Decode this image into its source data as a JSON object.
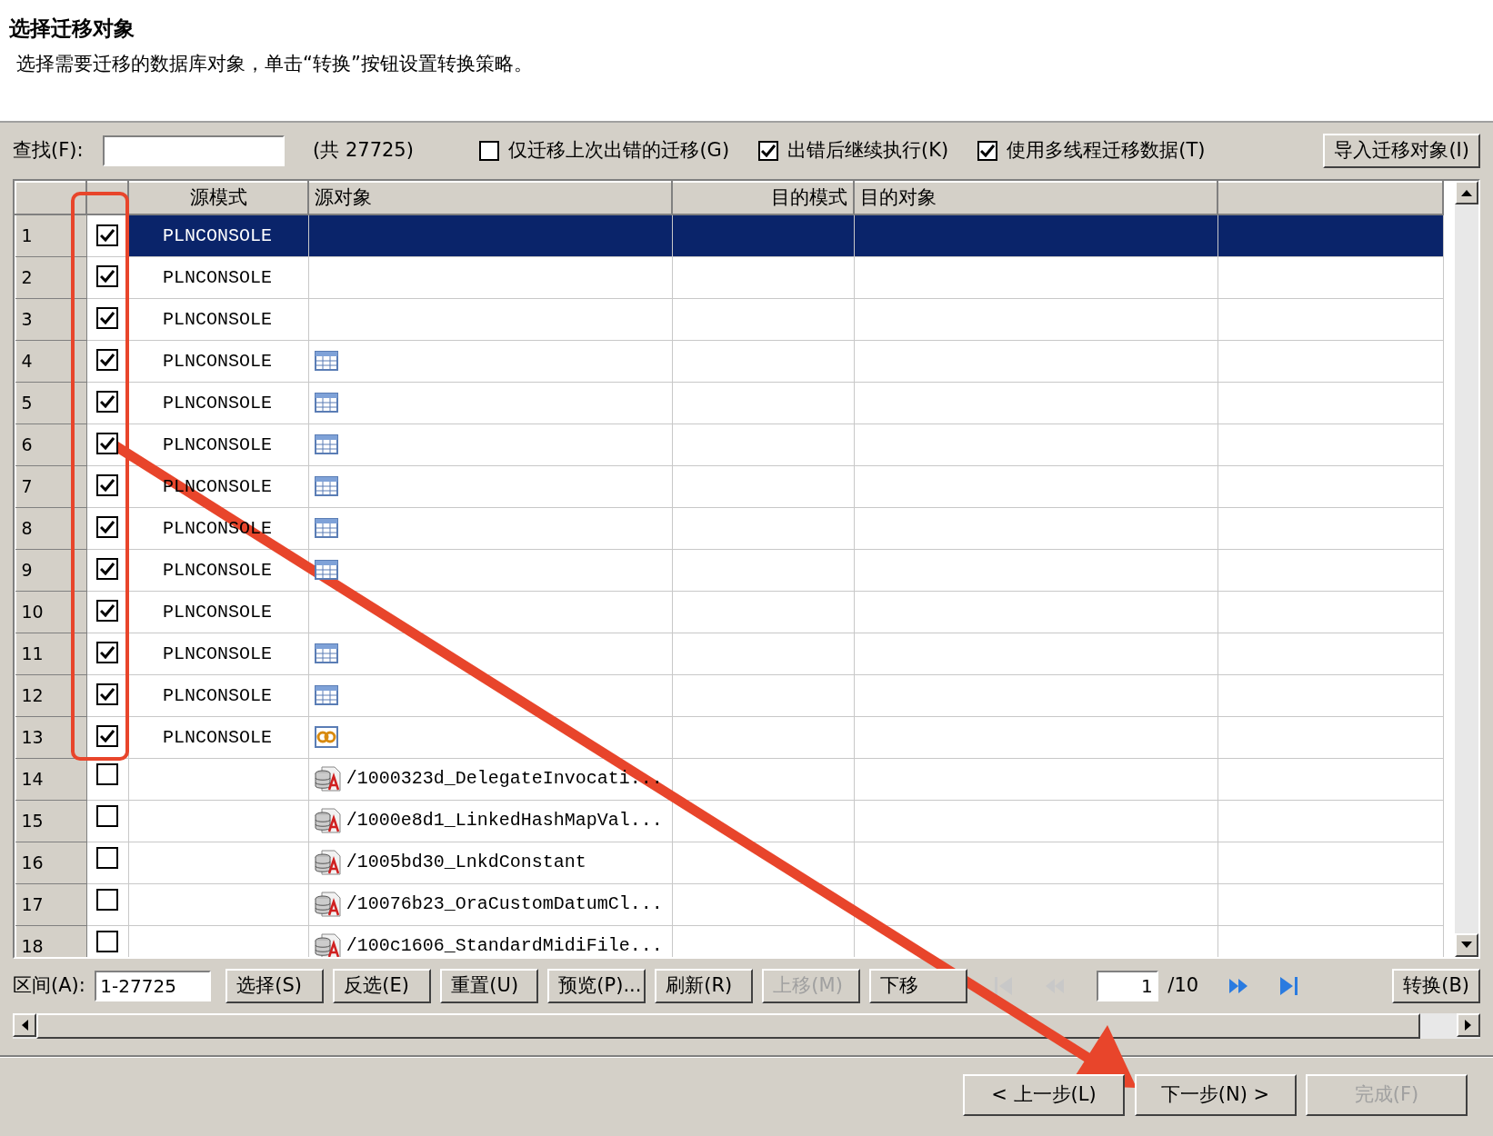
{
  "header": {
    "title": "选择迁移对象",
    "subtitle": "选择需要迁移的数据库对象，单击“转换”按钮设置转换策略。"
  },
  "toolbar": {
    "find_label": "查找(F):",
    "count": "(共 27725)",
    "options": [
      {
        "label": "仅迁移上次出错的迁移(G)",
        "checked": false
      },
      {
        "label": "出错后继续执行(K)",
        "checked": true
      },
      {
        "label": "使用多线程迁移数据(T)",
        "checked": true
      }
    ],
    "import_button": "导入迁移对象(I)"
  },
  "table": {
    "columns": [
      "源模式",
      "源对象",
      "目的模式",
      "目的对象"
    ],
    "rows": [
      {
        "number": "1",
        "checked": true,
        "selected": true,
        "source_schema": "PLNCONSOLE",
        "kind": "redacted"
      },
      {
        "number": "2",
        "checked": true,
        "selected": false,
        "source_schema": "PLNCONSOLE",
        "kind": "redacted"
      },
      {
        "number": "3",
        "checked": true,
        "selected": false,
        "source_schema": "PLNCONSOLE",
        "kind": "redacted"
      },
      {
        "number": "4",
        "checked": true,
        "selected": false,
        "source_schema": "PLNCONSOLE",
        "kind": "table"
      },
      {
        "number": "5",
        "checked": true,
        "selected": false,
        "source_schema": "PLNCONSOLE",
        "kind": "table"
      },
      {
        "number": "6",
        "checked": true,
        "selected": false,
        "source_schema": "PLNCONSOLE",
        "kind": "table"
      },
      {
        "number": "7",
        "checked": true,
        "selected": false,
        "source_schema": "PLNCONSOLE",
        "kind": "table"
      },
      {
        "number": "8",
        "checked": true,
        "selected": false,
        "source_schema": "PLNCONSOLE",
        "kind": "table"
      },
      {
        "number": "9",
        "checked": true,
        "selected": false,
        "source_schema": "PLNCONSOLE",
        "kind": "table"
      },
      {
        "number": "10",
        "checked": true,
        "selected": false,
        "source_schema": "PLNCONSOLE",
        "kind": "redacted"
      },
      {
        "number": "11",
        "checked": true,
        "selected": false,
        "source_schema": "PLNCONSOLE",
        "kind": "table"
      },
      {
        "number": "12",
        "checked": true,
        "selected": false,
        "source_schema": "PLNCONSOLE",
        "kind": "table"
      },
      {
        "number": "13",
        "checked": true,
        "selected": false,
        "source_schema": "PLNCONSOLE",
        "kind": "sequence"
      },
      {
        "number": "14",
        "checked": false,
        "selected": false,
        "kind": "java",
        "source_object": "/1000323d_DelegateInvocati..."
      },
      {
        "number": "15",
        "checked": false,
        "selected": false,
        "kind": "java",
        "source_object": "/1000e8d1_LinkedHashMapVal..."
      },
      {
        "number": "16",
        "checked": false,
        "selected": false,
        "kind": "java",
        "source_object": "/1005bd30_LnkdConstant"
      },
      {
        "number": "17",
        "checked": false,
        "selected": false,
        "kind": "java",
        "source_object": "/10076b23_OraCustomDatumCl..."
      },
      {
        "number": "18",
        "checked": false,
        "selected": false,
        "kind": "java",
        "source_object": "/100c1606_StandardMidiFile..."
      }
    ]
  },
  "controls": {
    "range_label": "区间(A):",
    "range_value": "1-27725",
    "buttons": [
      {
        "label": "选择(S)",
        "disabled": false
      },
      {
        "label": "反选(E)",
        "disabled": false
      },
      {
        "label": "重置(U)",
        "disabled": false
      },
      {
        "label": "预览(P)...",
        "disabled": false
      },
      {
        "label": "刷新(R)",
        "disabled": false
      },
      {
        "label": "上移(M)",
        "disabled": true
      },
      {
        "label": "下移",
        "disabled": false
      }
    ],
    "pager": {
      "first_disabled": true,
      "previous_disabled": true,
      "page": "1",
      "total": "/10"
    },
    "convert_button": "转换(B)"
  },
  "footer": {
    "buttons": [
      {
        "label": "< 上一步(L)",
        "disabled": false
      },
      {
        "label": "下一步(N) >",
        "disabled": false
      },
      {
        "label": "完成(F)",
        "disabled": true
      }
    ]
  },
  "annotations": {
    "box": {
      "color": "#e8452b"
    },
    "arrow": {
      "color": "#e8452b"
    }
  }
}
